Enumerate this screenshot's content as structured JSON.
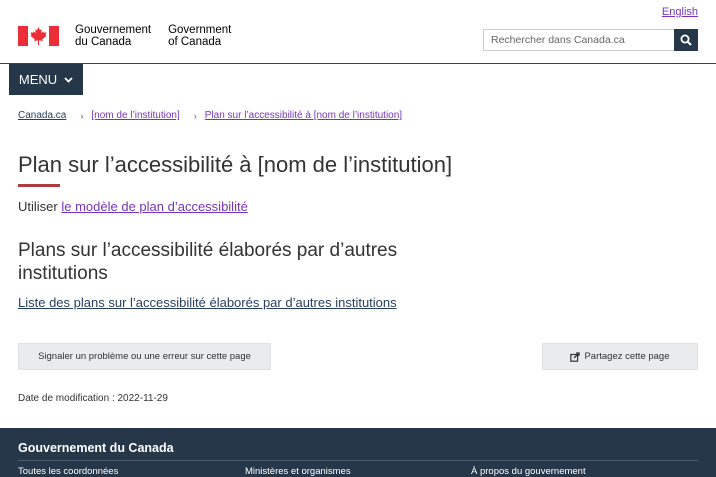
{
  "header": {
    "language_link": "English",
    "signature_fr": [
      "Gouvernement",
      "du Canada"
    ],
    "signature_en": [
      "Government",
      "of Canada"
    ],
    "search_placeholder": "Rechercher dans Canada.ca",
    "menu_label": "MENU"
  },
  "breadcrumb": [
    {
      "label": "Canada.ca"
    },
    {
      "label": "[nom de l’institution]"
    },
    {
      "label": "Plan sur l’accessibilité à [nom de l’institution]"
    }
  ],
  "main": {
    "title": "Plan sur l’accessibilité à [nom de l’institution]",
    "use_prefix": "Utiliser",
    "use_link": "le modèle de plan d’accessibilité",
    "section_heading": "Plans sur l’accessibilité élaborés par d’autres institutions",
    "plans_link": "Liste des plans sur l’accessibilité élaborés par d’autres institutions",
    "report_button": "Signaler un problème ou une erreur sur cette page",
    "share_button": "Partagez cette page",
    "date_modified": "Date de modification : 2022-11-29"
  },
  "footer": {
    "title": "Gouvernement du Canada",
    "links": [
      "Toutes les coordonnées",
      "Ministères et organismes",
      "À propos du gouvernement"
    ]
  },
  "colors": {
    "navy": "#26374a",
    "visited_link": "#7834bc",
    "link": "#284162",
    "accent_red": "#af3c43",
    "flag_red": "#eb2d37"
  },
  "icons": [
    "canada-flag-icon",
    "search-icon",
    "chevron-down-icon",
    "share-icon"
  ]
}
